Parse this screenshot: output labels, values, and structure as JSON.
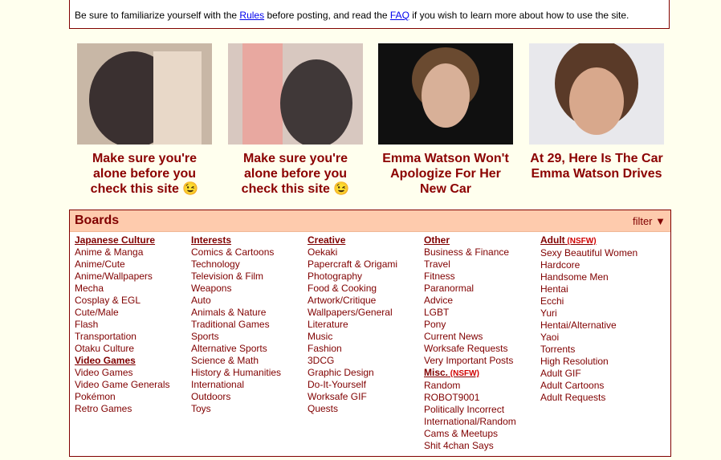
{
  "notice": {
    "prefix": "Be sure to familiarize yourself with the ",
    "rules_link": "Rules",
    "middle": " before posting, and read the ",
    "faq_link": "FAQ",
    "suffix": " if you wish to learn more about how to use the site."
  },
  "ads": [
    {
      "caption": "Make sure you're alone before you check this site 😉",
      "colors": [
        "#c8b7a6",
        "#3a3030",
        "#e8d8c8"
      ]
    },
    {
      "caption": "Make sure you're alone before you check this site 😉",
      "colors": [
        "#d8c8c0",
        "#e8a8a0",
        "#403838"
      ]
    },
    {
      "caption": "Emma Watson Won't Apologize For Her New Car",
      "colors": [
        "#101010",
        "#d8b098",
        "#6a4a30"
      ]
    },
    {
      "caption": "At 29, Here Is The Car Emma Watson Drives",
      "colors": [
        "#e8e8ec",
        "#d8a88c",
        "#5a3a28"
      ]
    }
  ],
  "boards": {
    "title": "Boards",
    "filter": "filter ▼",
    "columns": [
      {
        "sections": [
          {
            "title": "Japanese Culture",
            "nsfw": "",
            "items": [
              "Anime & Manga",
              "Anime/Cute",
              "Anime/Wallpapers",
              "Mecha",
              "Cosplay & EGL",
              "Cute/Male",
              "Flash",
              "Transportation",
              "Otaku Culture"
            ]
          },
          {
            "title": "Video Games",
            "nsfw": "",
            "items": [
              "Video Games",
              "Video Game Generals",
              "Pokémon",
              "Retro Games"
            ]
          }
        ]
      },
      {
        "sections": [
          {
            "title": "Interests",
            "nsfw": "",
            "items": [
              "Comics & Cartoons",
              "Technology",
              "Television & Film",
              "Weapons",
              "Auto",
              "Animals & Nature",
              "Traditional Games",
              "Sports",
              "Alternative Sports",
              "Science & Math",
              "History & Humanities",
              "International",
              "Outdoors",
              "Toys"
            ]
          }
        ]
      },
      {
        "sections": [
          {
            "title": "Creative",
            "nsfw": "",
            "items": [
              "Oekaki",
              "Papercraft & Origami",
              "Photography",
              "Food & Cooking",
              "Artwork/Critique",
              "Wallpapers/General",
              "Literature",
              "Music",
              "Fashion",
              "3DCG",
              "Graphic Design",
              "Do-It-Yourself",
              "Worksafe GIF",
              "Quests"
            ]
          }
        ]
      },
      {
        "sections": [
          {
            "title": "Other",
            "nsfw": "",
            "items": [
              "Business & Finance",
              "Travel",
              "Fitness",
              "Paranormal",
              "Advice",
              "LGBT",
              "Pony",
              "Current News",
              "Worksafe Requests",
              "Very Important Posts"
            ]
          },
          {
            "title": "Misc.",
            "nsfw": "(NSFW)",
            "items": [
              "Random",
              "ROBOT9001",
              "Politically Incorrect",
              "International/Random",
              "Cams & Meetups",
              "Shit 4chan Says"
            ]
          }
        ]
      },
      {
        "sections": [
          {
            "title": "Adult",
            "nsfw": "(NSFW)",
            "items": [
              "Sexy Beautiful Women",
              "Hardcore",
              "Handsome Men",
              "Hentai",
              "Ecchi",
              "Yuri",
              "Hentai/Alternative",
              "Yaoi",
              "Torrents",
              "High Resolution",
              "Adult GIF",
              "Adult Cartoons",
              "Adult Requests"
            ]
          }
        ]
      }
    ]
  }
}
